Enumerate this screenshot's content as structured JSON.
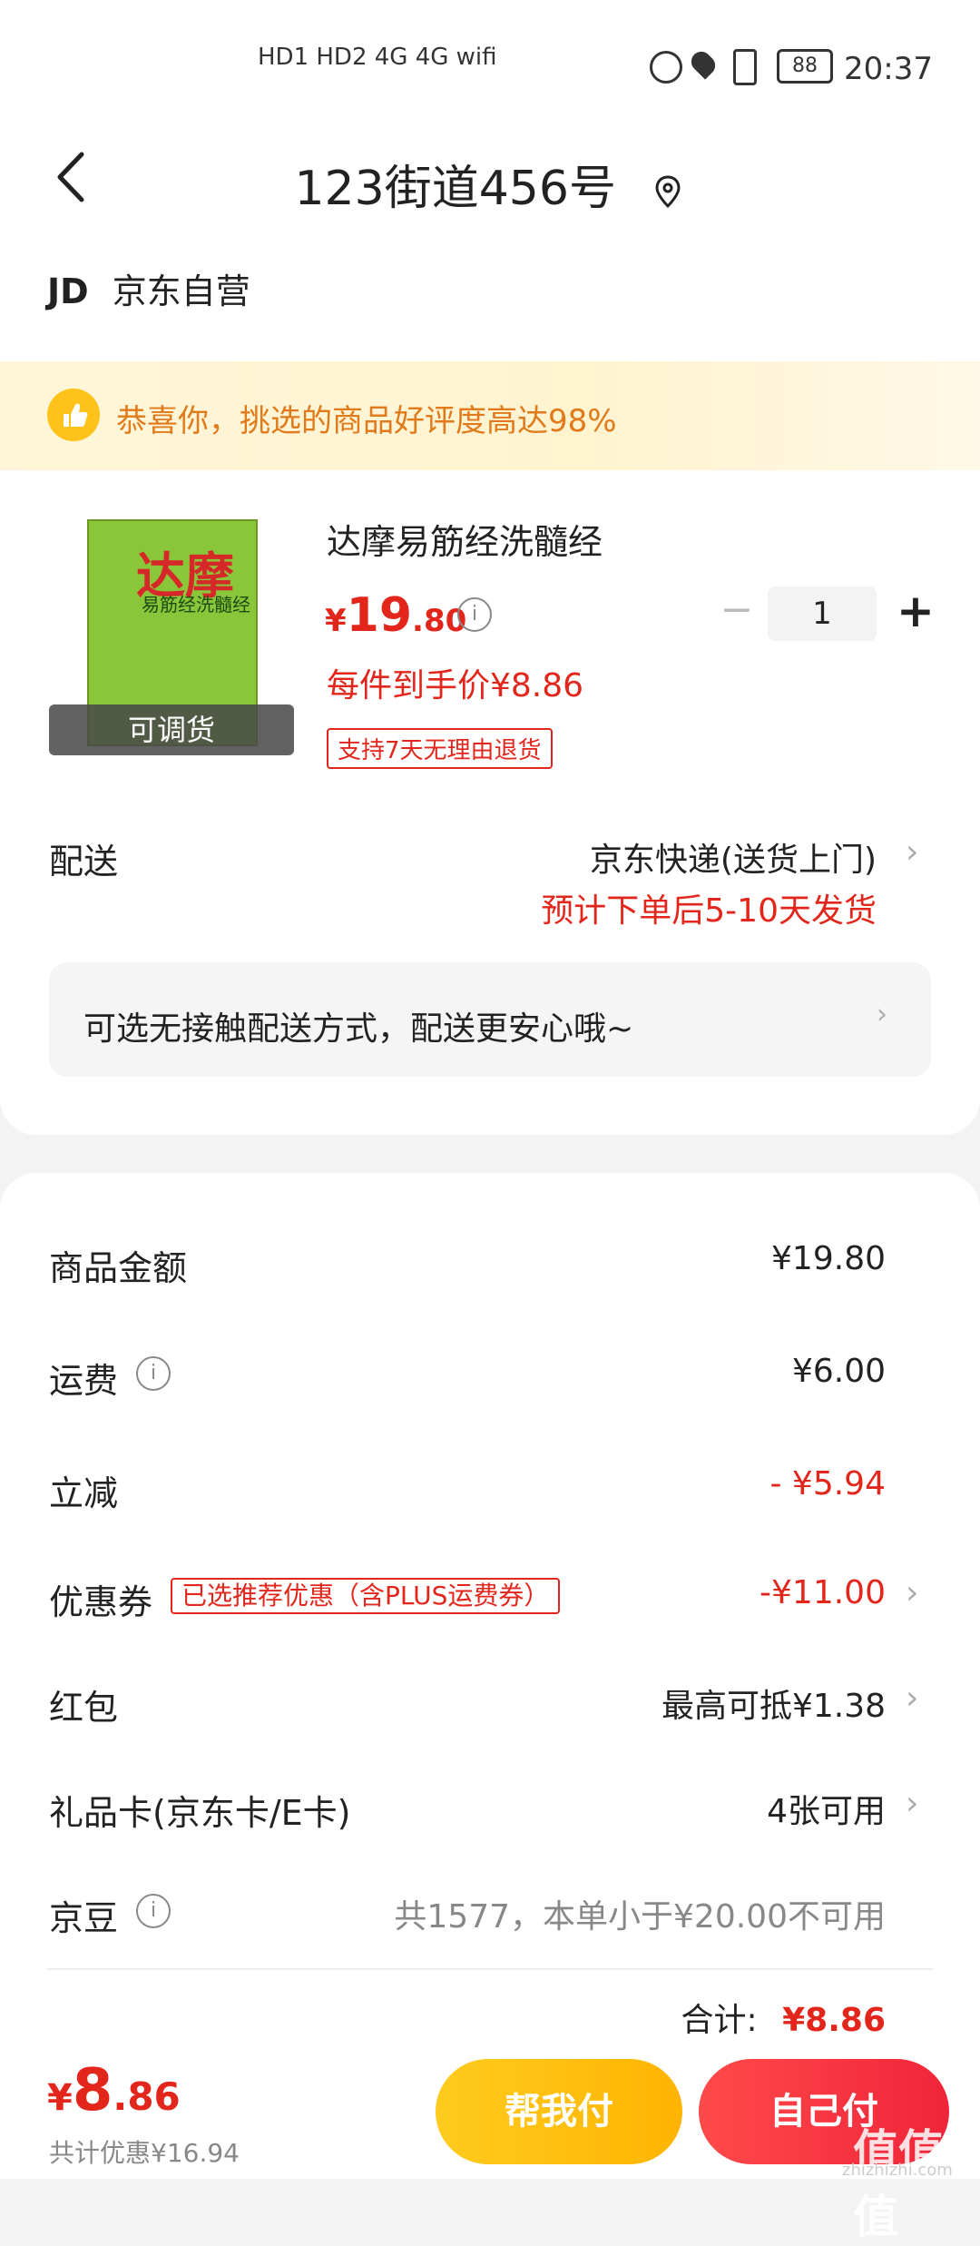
{
  "status": {
    "left_icons": "HD1 HD2 4G 4G wifi",
    "battery": "88",
    "time": "20:37"
  },
  "header": {
    "address": "123街道456号",
    "shop_logo": "JD",
    "shop_name": "京东自营"
  },
  "banner": {
    "text": "恭喜你，挑选的商品好评度高达98%"
  },
  "product": {
    "name": "达摩易筋经洗髓经",
    "cover_title": "达摩",
    "cover_sub": "易筋经洗髓经",
    "stock_tag": "可调货",
    "price_currency": "¥",
    "price_int": "19",
    "price_dec": ".80",
    "unit_price": "每件到手价¥8.86",
    "return_tag": "支持7天无理由退货",
    "qty": "1",
    "minus": "−",
    "plus": "+"
  },
  "delivery": {
    "label": "配送",
    "method": "京东快递(送货上门)",
    "eta": "预计下单后5-10天发货",
    "contactless": "可选无接触配送方式，配送更安心哦~"
  },
  "summary": {
    "goods_label": "商品金额",
    "goods_value": "¥19.80",
    "freight_label": "运费",
    "freight_value": "¥6.00",
    "discount_label": "立减",
    "discount_value": "- ¥5.94",
    "coupon_label": "优惠券",
    "coupon_tag": "已选推荐优惠（含PLUS运费券）",
    "coupon_value": "-¥11.00",
    "redpacket_label": "红包",
    "redpacket_value": "最高可抵¥1.38",
    "giftcard_label": "礼品卡(京东卡/E卡)",
    "giftcard_value": "4张可用",
    "jingdou_label": "京豆",
    "jingdou_value": "共1577，本单小于¥20.00不可用",
    "total_label": "合计:",
    "total_value": "¥8.86"
  },
  "bottom": {
    "currency": "¥",
    "amount_int": "8",
    "amount_dec": ".86",
    "saved": "共计优惠¥16.94",
    "help_pay": "帮我付",
    "self_pay": "自己付",
    "watermark": "值值值",
    "watermark_sub": "zhizhizhi.com"
  },
  "colors": {
    "accent_red": "#e3261c",
    "banner_orange": "#e07a1a",
    "help_button": "#ffbd14",
    "self_button": "#f0243a"
  }
}
